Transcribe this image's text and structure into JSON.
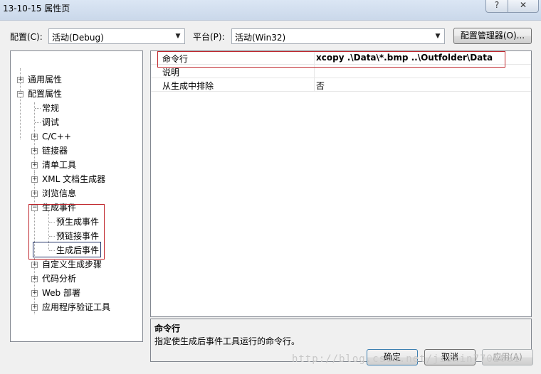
{
  "window": {
    "title": "13-10-15 属性页",
    "help_label": "?",
    "close_label": "✕"
  },
  "config_bar": {
    "config_label": "配置(C):",
    "config_value": "活动(Debug)",
    "platform_label": "平台(P):",
    "platform_value": "活动(Win32)",
    "manager_button": "配置管理器(O)..."
  },
  "tree": {
    "items": [
      {
        "label": "通用属性",
        "expander": "+"
      },
      {
        "label": "配置属性",
        "expander": "−"
      },
      {
        "label": "常规"
      },
      {
        "label": "调试"
      },
      {
        "label": "C/C++",
        "expander": "+"
      },
      {
        "label": "链接器",
        "expander": "+"
      },
      {
        "label": "清单工具",
        "expander": "+"
      },
      {
        "label": "XML 文档生成器",
        "expander": "+"
      },
      {
        "label": "浏览信息",
        "expander": "+"
      },
      {
        "label": "生成事件",
        "expander": "−"
      },
      {
        "label": "预生成事件"
      },
      {
        "label": "预链接事件"
      },
      {
        "label": "生成后事件"
      },
      {
        "label": "自定义生成步骤",
        "expander": "+"
      },
      {
        "label": "代码分析",
        "expander": "+"
      },
      {
        "label": "Web 部署",
        "expander": "+"
      },
      {
        "label": "应用程序验证工具",
        "expander": "+"
      }
    ]
  },
  "grid": {
    "rows": [
      {
        "name": "命令行",
        "value": "xcopy .\\Data\\*.bmp ..\\Outfolder\\Data"
      },
      {
        "name": "说明",
        "value": ""
      },
      {
        "name": "从生成中排除",
        "value": "否"
      }
    ]
  },
  "description": {
    "title": "命令行",
    "text": "指定使生成后事件工具运行的命令行。"
  },
  "buttons": {
    "ok": "确定",
    "cancel": "取消",
    "apply": "应用(A)"
  },
  "watermark": "http://blog.csdn.net/jiaxin7702001",
  "colors": {
    "highlight_box": "#c0282e",
    "selection_box": "#26366b"
  }
}
